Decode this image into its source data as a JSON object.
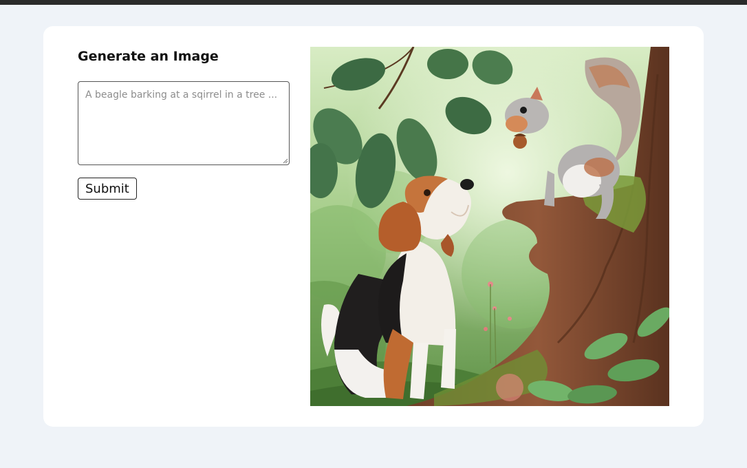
{
  "form": {
    "title": "Generate an Image",
    "prompt_placeholder": "A beagle barking at a sqirrel in a tree ...",
    "prompt_value": "",
    "submit_label": "Submit"
  },
  "result": {
    "image_subject": "beagle looking up at a squirrel holding an acorn on a mossy tree trunk in a green forest"
  },
  "colors": {
    "page_background": "#eff3f8",
    "card_background": "#ffffff",
    "top_bar": "#2b2b2b"
  }
}
